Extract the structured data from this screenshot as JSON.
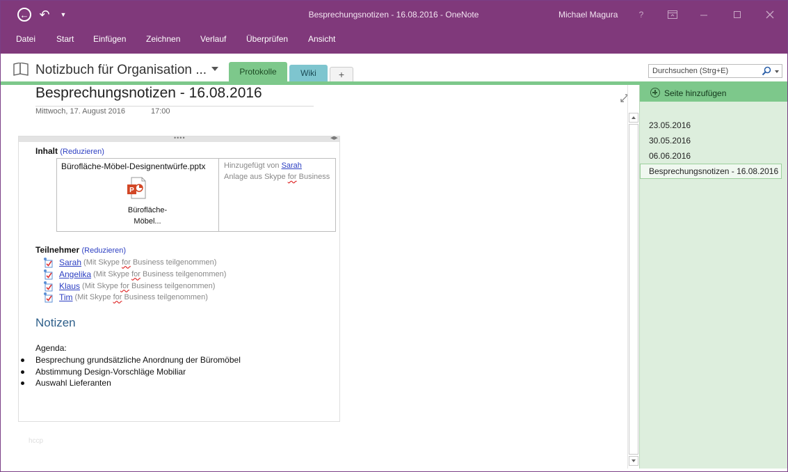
{
  "window": {
    "title": "Besprechungsnotizen - 16.08.2016 - OneNote",
    "user": "Michael Magura",
    "help_label": "?"
  },
  "menu": {
    "items": [
      "Datei",
      "Start",
      "Einfügen",
      "Zeichnen",
      "Verlauf",
      "Überprüfen",
      "Ansicht"
    ]
  },
  "notebook": {
    "name": "Notizbuch für Organisation ...",
    "tabs": [
      "Protokolle",
      "Wiki",
      "+"
    ],
    "active_tab": "Protokolle"
  },
  "search": {
    "placeholder": "Durchsuchen (Strg+E)"
  },
  "page": {
    "title": "Besprechungsnotizen - 16.08.2016",
    "date": "Mittwoch, 17. August 2016",
    "time": "17:00",
    "content_section": {
      "heading": "Inhalt",
      "collapse_label": "(Reduzieren)",
      "attachment": {
        "filename": "Bürofläche-Möbel-Designentwürfe.pptx",
        "caption_line1": "Bürofläche-",
        "caption_line2": "Möbel...",
        "added_by_prefix": "Hinzugefügt von",
        "added_by_name": "Sarah",
        "source_prefix": "Anlage aus Skype",
        "source_for": "for",
        "source_suffix": "Business"
      }
    },
    "participants_section": {
      "heading": "Teilnehmer",
      "collapse_label": "(Reduzieren)",
      "note_prefix": "(Mit Skype",
      "note_for": "for",
      "note_suffix": "Business teilgenommen)",
      "people": [
        "Sarah",
        "Angelika",
        "Klaus",
        "Tim"
      ]
    },
    "notes": {
      "heading": "Notizen",
      "agenda_label": "Agenda:",
      "items": [
        "Besprechung grundsätzliche Anordnung der Büromöbel",
        "Abstimmung Design-Vorschläge Mobiliar",
        "Auswahl Lieferanten"
      ]
    },
    "faint_text": "hccp"
  },
  "pages_pane": {
    "add_page_label": "Seite hinzufügen",
    "pages": [
      "23.05.2016",
      "30.05.2016",
      "06.06.2016",
      "Besprechungsnotizen - 16.08.2016"
    ],
    "selected_page": "Besprechungsnotizen - 16.08.2016"
  },
  "colors": {
    "title_bar": "#80397b",
    "section_tab": "#7dc88b",
    "wiki_tab": "#7ec5cf",
    "pages_pane_bg": "#ddeedd",
    "link": "#2b3ec2",
    "notes_heading": "#2e5f8a"
  },
  "icons": {
    "back": "back-arrow-circle-icon",
    "undo": "undo-icon",
    "qat": "customize-quick-access-icon",
    "notebook": "notebook-icon",
    "search": "magnifier-icon",
    "expand": "expand-icon",
    "attachment": "powerpoint-file-icon",
    "participant": "participant-checkbox-icon",
    "add_page": "plus-circle-icon"
  }
}
